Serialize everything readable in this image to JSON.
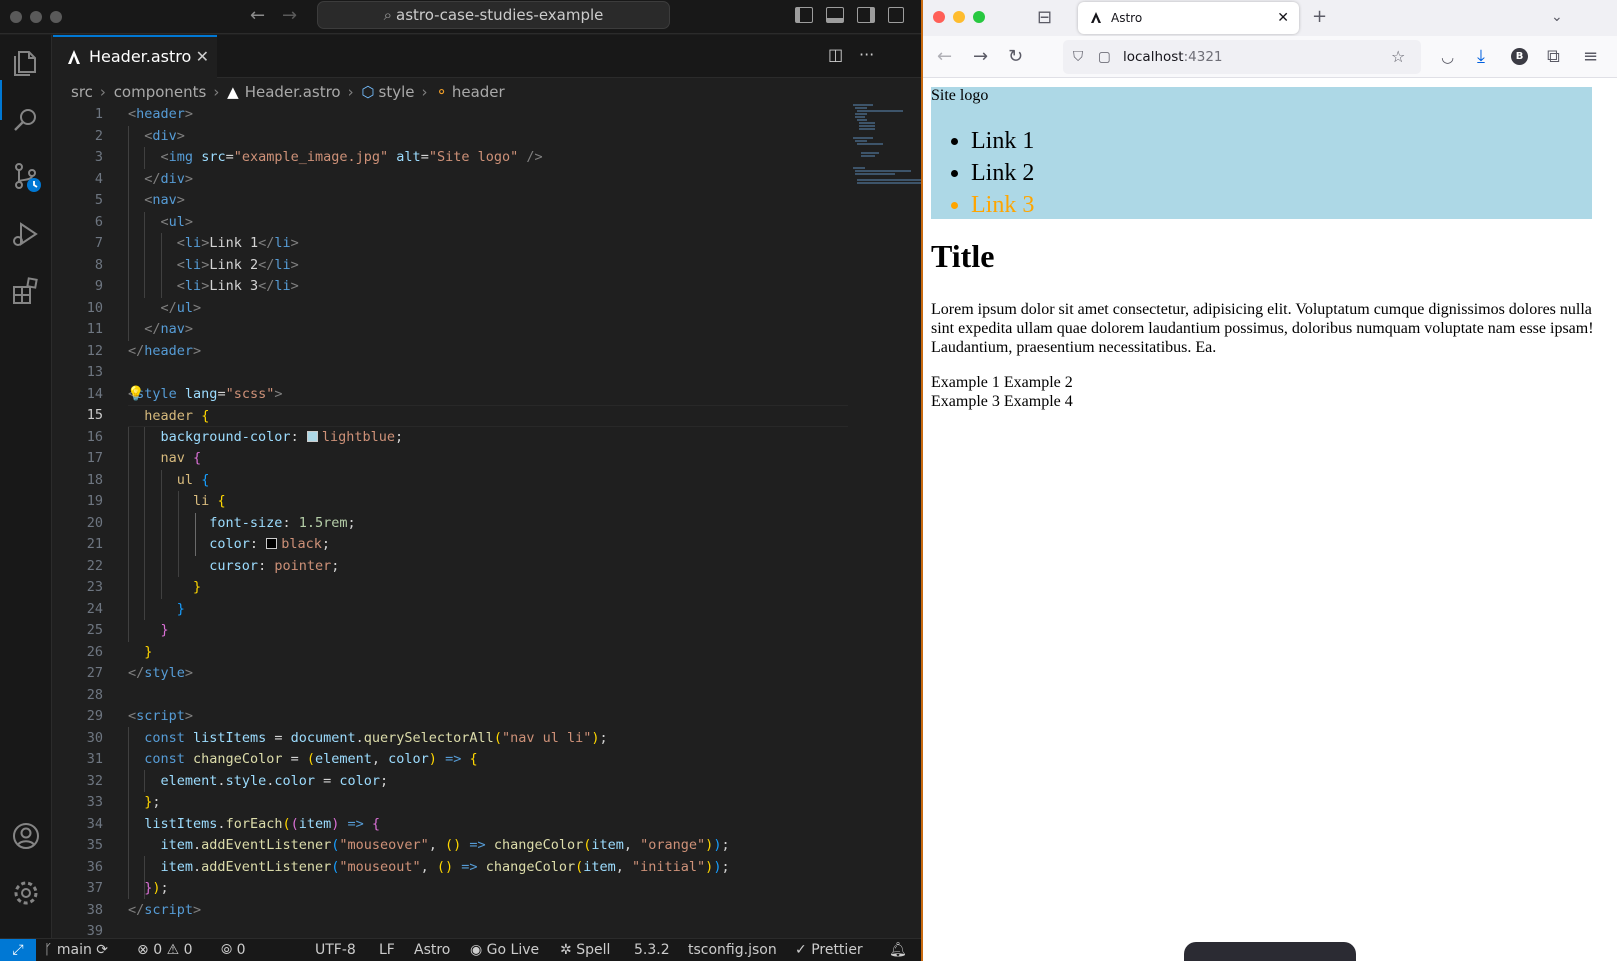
{
  "vscode": {
    "command_center": "astro-case-studies-example",
    "tab": {
      "label": "Header.astro",
      "close": "✕"
    },
    "breadcrumb": [
      "src",
      "components",
      "Header.astro",
      "style",
      "header"
    ],
    "line_numbers": [
      "1",
      "2",
      "3",
      "4",
      "5",
      "6",
      "7",
      "8",
      "9",
      "10",
      "11",
      "12",
      "13",
      "14",
      "15",
      "16",
      "17",
      "18",
      "19",
      "20",
      "21",
      "22",
      "23",
      "24",
      "25",
      "26",
      "27",
      "28",
      "29",
      "30",
      "31",
      "32",
      "33",
      "34",
      "35",
      "36",
      "37",
      "38",
      "39"
    ],
    "current_line": "15",
    "code": {
      "l1_open": "<",
      "l1_tag": "header",
      "l1_close": ">",
      "l2_tag": "div",
      "l3_tag": "img",
      "l3_a1": "src",
      "l3_v1": "\"example_image.jpg\"",
      "l3_a2": "alt",
      "l3_v2": "\"Site logo\"",
      "l3_end": "/>",
      "l4_tag": "div",
      "l5_tag": "nav",
      "l6_tag": "ul",
      "l7_tag": "li",
      "l7_text": "Link 1",
      "l8_tag": "li",
      "l8_text": "Link 2",
      "l9_tag": "li",
      "l9_text": "Link 3",
      "l10_tag": "ul",
      "l11_tag": "nav",
      "l12_tag": "header",
      "l14_tag": "style",
      "l14_attr": "lang",
      "l14_val": "\"scss\"",
      "l15_sel": "header",
      "l16_prop": "background-color",
      "l16_val": "lightblue",
      "l17_sel": "nav",
      "l18_sel": "ul",
      "l19_sel": "li",
      "l20_prop": "font-size",
      "l20_val": "1.5rem",
      "l21_prop": "color",
      "l21_val": "black",
      "l22_prop": "cursor",
      "l22_val": "pointer",
      "l27_tag": "style",
      "l29_tag": "script",
      "l30_kw": "const",
      "l30_var": "listItems",
      "l30_obj": "document",
      "l30_fn": "querySelectorAll",
      "l30_str": "\"nav ul li\"",
      "l31_kw": "const",
      "l31_fn": "changeColor",
      "l31_p1": "element",
      "l31_p2": "color",
      "l32_a": "element",
      "l32_b": "style",
      "l32_c": "color",
      "l32_d": "color",
      "l34_var": "listItems",
      "l34_fn": "forEach",
      "l34_p": "item",
      "l35_obj": "item",
      "l35_fn": "addEventListener",
      "l35_ev": "\"mouseover\"",
      "l35_call": "changeColor",
      "l35_arg": "item",
      "l35_val": "\"orange\"",
      "l36_obj": "item",
      "l36_fn": "addEventListener",
      "l36_ev": "\"mouseout\"",
      "l36_call": "changeColor",
      "l36_arg": "item",
      "l36_val": "\"initial\"",
      "l38_tag": "script"
    },
    "status": {
      "branch": "main",
      "errors": "0",
      "warnings": "0",
      "ports": "0",
      "encoding": "UTF-8",
      "eol": "LF",
      "language": "Astro",
      "go_live": "Go Live",
      "spell": "Spell",
      "version": "5.3.2",
      "tsconfig": "tsconfig.json",
      "prettier": "Prettier"
    },
    "colors": {
      "accent": "#0078d4",
      "swatch_lightblue": "#add8e6",
      "swatch_black": "#000000"
    }
  },
  "browser": {
    "tab_title": "Astro",
    "url_host": "localhost",
    "url_port": ":4321",
    "profile_badge": "B",
    "page": {
      "site_logo": "Site logo",
      "links": [
        "Link 1",
        "Link 2",
        "Link 3"
      ],
      "hovered_link": "Link 3",
      "title": "Title",
      "paragraph": "Lorem ipsum dolor sit amet consectetur, adipisicing elit. Voluptatum cumque dignissimos dolores nulla sint expedita ullam quae dolorem laudantium possimus, doloribus numquam voluptate nam esse ipsam! Laudantium, praesentium necessitatibus. Ea.",
      "examples_row1": "Example 1 Example 2",
      "examples_row2": "Example 3 Example 4"
    },
    "colors": {
      "header_bg": "#add8e6",
      "hover_link": "#ffa500",
      "window_border": "#c86a10"
    }
  }
}
